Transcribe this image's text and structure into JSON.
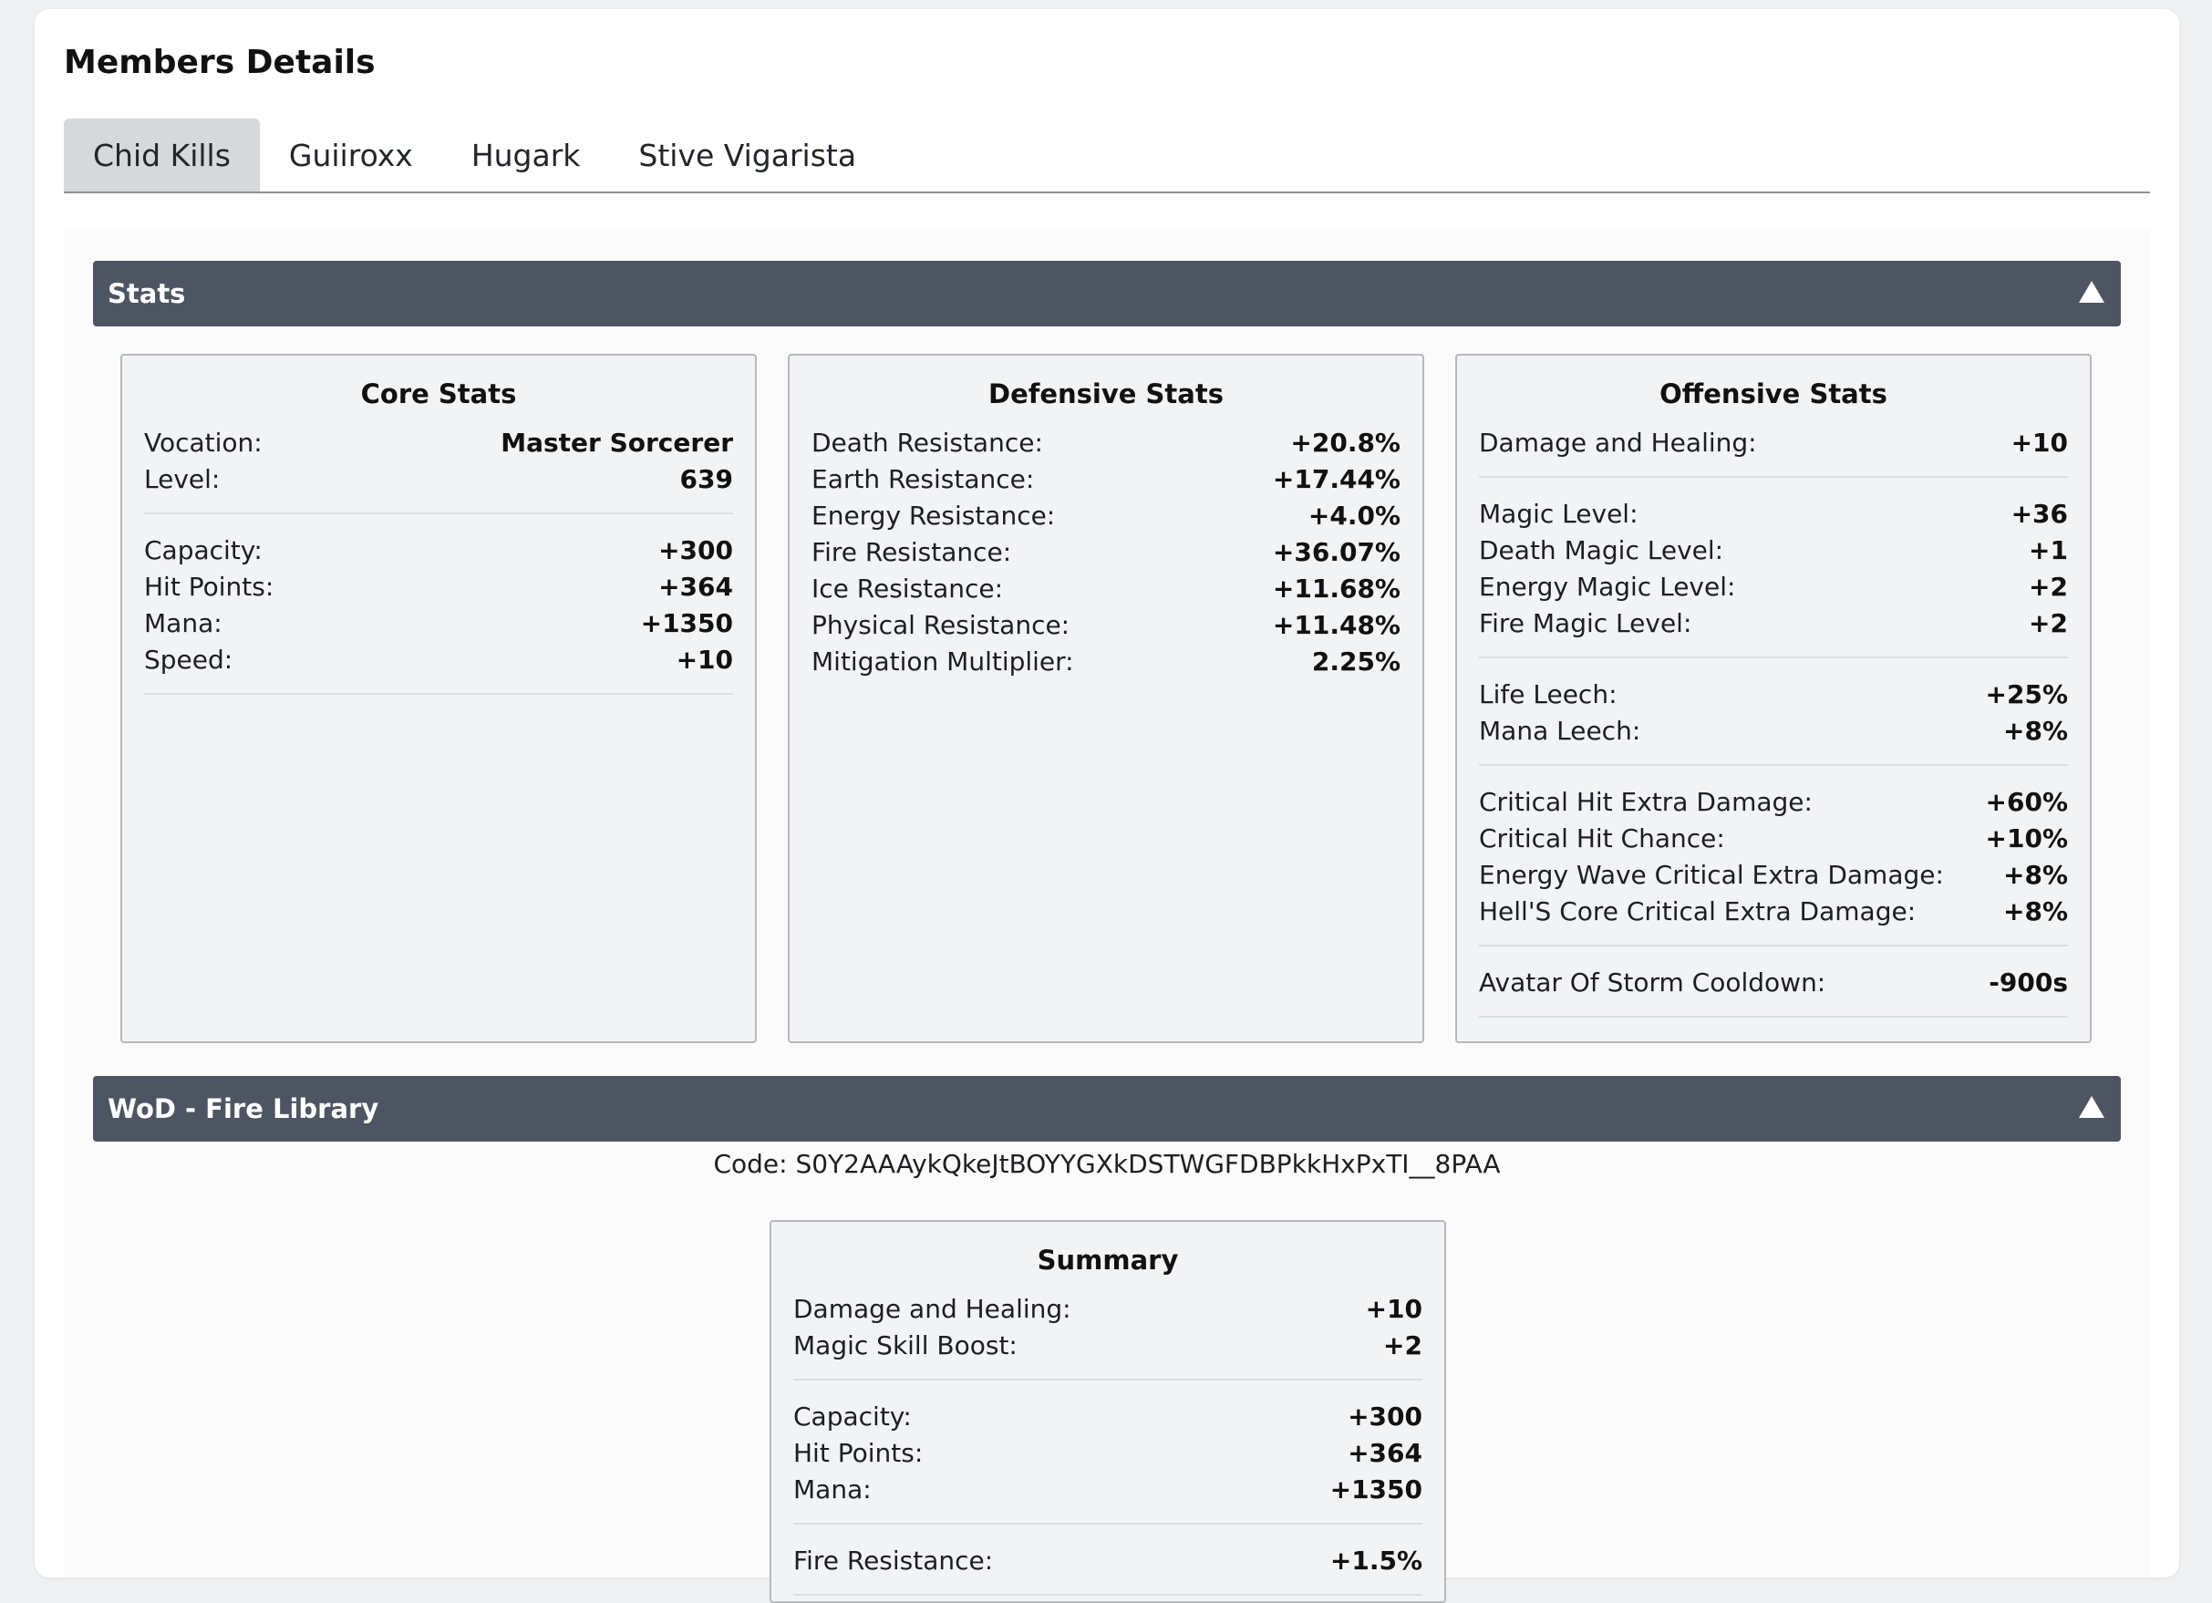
{
  "page": {
    "title": "Members Details"
  },
  "tabs": [
    {
      "label": "Chid Kills",
      "active": true
    },
    {
      "label": "Guiiroxx",
      "active": false
    },
    {
      "label": "Hugark",
      "active": false
    },
    {
      "label": "Stive Vigarista",
      "active": false
    }
  ],
  "stats_section": {
    "title": "Stats",
    "core": {
      "title": "Core Stats",
      "groups": [
        [
          {
            "label": "Vocation:",
            "value": "Master Sorcerer"
          },
          {
            "label": "Level:",
            "value": "639"
          }
        ],
        [
          {
            "label": "Capacity:",
            "value": "+300"
          },
          {
            "label": "Hit Points:",
            "value": "+364"
          },
          {
            "label": "Mana:",
            "value": "+1350"
          },
          {
            "label": "Speed:",
            "value": "+10"
          }
        ]
      ]
    },
    "defensive": {
      "title": "Defensive Stats",
      "rows": [
        {
          "label": "Death Resistance:",
          "value": "+20.8%"
        },
        {
          "label": "Earth Resistance:",
          "value": "+17.44%"
        },
        {
          "label": "Energy Resistance:",
          "value": "+4.0%"
        },
        {
          "label": "Fire Resistance:",
          "value": "+36.07%"
        },
        {
          "label": "Ice Resistance:",
          "value": "+11.68%"
        },
        {
          "label": "Physical Resistance:",
          "value": "+11.48%"
        },
        {
          "label": "Mitigation Multiplier:",
          "value": "2.25%"
        }
      ]
    },
    "offensive": {
      "title": "Offensive Stats",
      "groups": [
        [
          {
            "label": "Damage and Healing:",
            "value": "+10"
          }
        ],
        [
          {
            "label": "Magic Level:",
            "value": "+36"
          },
          {
            "label": "Death Magic Level:",
            "value": "+1"
          },
          {
            "label": "Energy Magic Level:",
            "value": "+2"
          },
          {
            "label": "Fire Magic Level:",
            "value": "+2"
          }
        ],
        [
          {
            "label": "Life Leech:",
            "value": "+25%"
          },
          {
            "label": "Mana Leech:",
            "value": "+8%"
          }
        ],
        [
          {
            "label": "Critical Hit Extra Damage:",
            "value": "+60%"
          },
          {
            "label": "Critical Hit Chance:",
            "value": "+10%"
          },
          {
            "label": "Energy Wave Critical Extra Damage:",
            "value": "+8%"
          },
          {
            "label": "Hell'S Core Critical Extra Damage:",
            "value": "+8%"
          }
        ],
        [
          {
            "label": "Avatar Of Storm Cooldown:",
            "value": "-900s"
          }
        ]
      ]
    }
  },
  "wod_section": {
    "title": "WoD - Fire Library",
    "code": "Code: S0Y2AAAykQkeJtBOYYGXkDSTWGFDBPkkHxPxTI__8PAA",
    "summary": {
      "title": "Summary",
      "groups": [
        [
          {
            "label": "Damage and Healing:",
            "value": "+10"
          },
          {
            "label": "Magic Skill Boost:",
            "value": "+2"
          }
        ],
        [
          {
            "label": "Capacity:",
            "value": "+300"
          },
          {
            "label": "Hit Points:",
            "value": "+364"
          },
          {
            "label": "Mana:",
            "value": "+1350"
          }
        ],
        [
          {
            "label": "Fire Resistance:",
            "value": "+1.5%"
          }
        ]
      ]
    }
  },
  "colors": {
    "section_header_bg": "#4e5562",
    "active_tab_bg": "#d6d8dc",
    "stat_box_bg": "#f2f3f5"
  },
  "icons": {
    "collapse": "caret-up-icon"
  }
}
